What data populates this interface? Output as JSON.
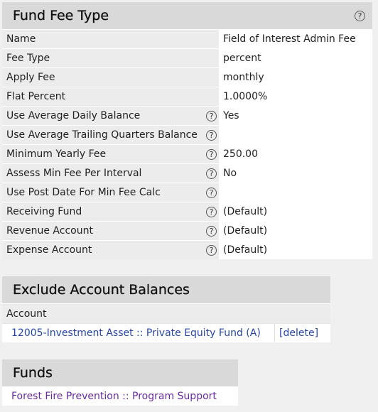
{
  "fee_type": {
    "title": "Fund Fee Type",
    "rows": [
      {
        "label": "Name",
        "value": "Field of Interest Admin Fee",
        "help": false
      },
      {
        "label": "Fee Type",
        "value": "percent",
        "help": false
      },
      {
        "label": "Apply Fee",
        "value": "monthly",
        "help": false
      },
      {
        "label": "Flat Percent",
        "value": "1.0000%",
        "help": false
      },
      {
        "label": "Use Average Daily Balance",
        "value": "Yes",
        "help": true
      },
      {
        "label": "Use Average Trailing Quarters Balance",
        "value": "",
        "help": true
      },
      {
        "label": "Minimum Yearly Fee",
        "value": "250.00",
        "help": true
      },
      {
        "label": "Assess Min Fee Per Interval",
        "value": "No",
        "help": true
      },
      {
        "label": "Use Post Date For Min Fee Calc",
        "value": "",
        "help": true
      },
      {
        "label": "Receiving Fund",
        "value": "(Default)",
        "help": true
      },
      {
        "label": "Revenue Account",
        "value": "(Default)",
        "help": true
      },
      {
        "label": "Expense Account",
        "value": "(Default)",
        "help": true
      }
    ]
  },
  "exclude": {
    "title": "Exclude Account Balances",
    "column": "Account",
    "rows": [
      {
        "account": "12005-Investment Asset :: Private Equity Fund (A)",
        "action": "[delete]"
      }
    ]
  },
  "funds": {
    "title": "Funds",
    "items": [
      "Forest Fire Prevention :: Program Support"
    ]
  },
  "icons": {
    "help": "question-circle-icon"
  },
  "colors": {
    "header_bg": "#d9d9d9",
    "label_bg": "#ececec",
    "link": "#2446a8",
    "visited_link": "#6a2aa3"
  }
}
